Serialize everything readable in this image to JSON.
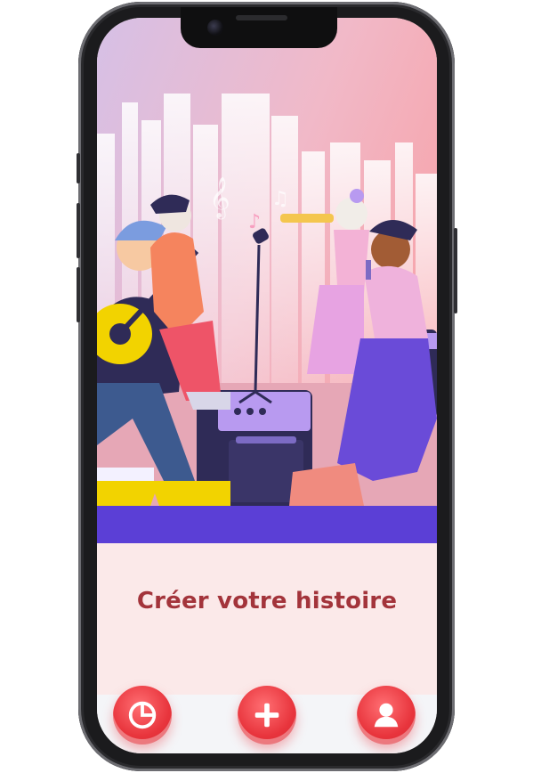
{
  "main": {
    "cta_title": "Créer votre histoire"
  },
  "bottom_nav": {
    "items": [
      {
        "name": "stats",
        "icon": "pie-chart-icon"
      },
      {
        "name": "create",
        "icon": "plus-icon"
      },
      {
        "name": "profile",
        "icon": "user-icon"
      }
    ]
  },
  "colors": {
    "accent": "#e8343c",
    "title": "#a3343b",
    "screen_bg": "#fbe9e9",
    "stage": "#5b3fd6",
    "nav_bg": "#f4f5f8"
  }
}
